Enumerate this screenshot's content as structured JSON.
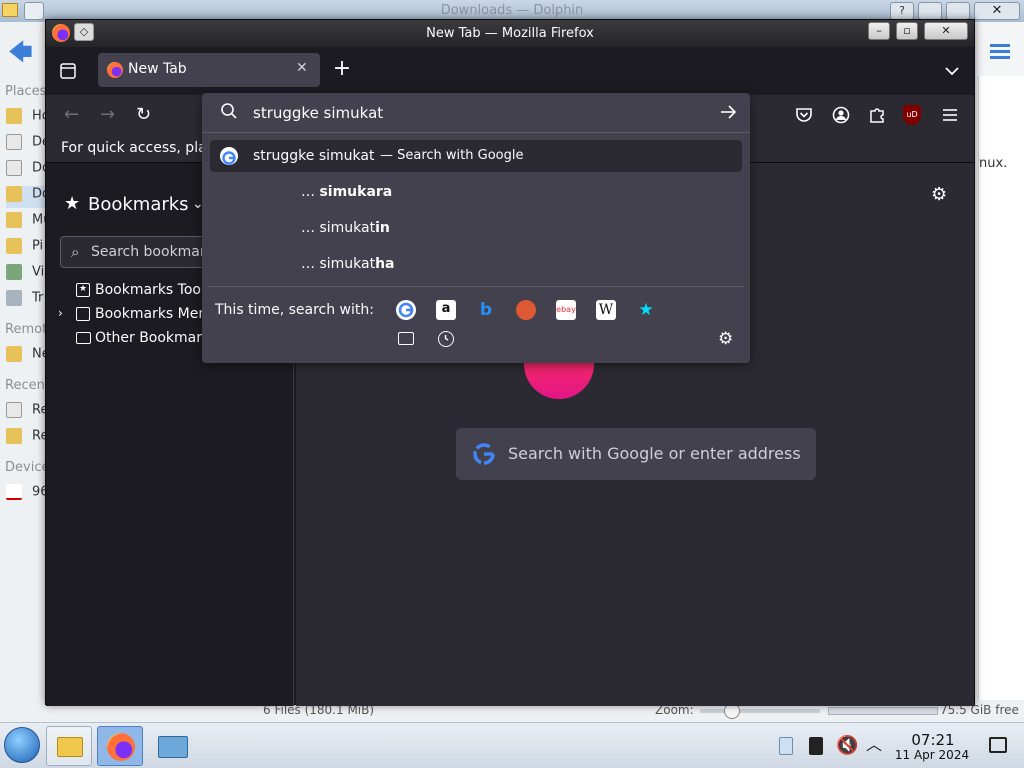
{
  "dolphin": {
    "title": "Downloads — Dolphin",
    "sidebar": {
      "places_label": "Places",
      "items_places": [
        "Ho",
        "De",
        "Do",
        "Do",
        "Mu",
        "Pi",
        "Vi",
        "Tr"
      ],
      "remote_label": "Remote",
      "items_remote": [
        "Ne"
      ],
      "recent_label": "Recent",
      "items_recent": [
        "Re",
        "Re"
      ],
      "devices_label": "Devices",
      "items_devices": [
        "96"
      ]
    },
    "right_text": "nux.",
    "status": {
      "files": "6 Files (180.1 MiB)",
      "zoom_label": "Zoom:",
      "free": "75.5 GiB free"
    }
  },
  "firefox": {
    "window_title": "New Tab — Mozilla Firefox",
    "tab_title": "New Tab",
    "bookmarks_bar_text": "For quick access, plac",
    "sidebar": {
      "title": "Bookmarks",
      "search_placeholder": "Search bookmar",
      "items": [
        "Bookmarks Tooll",
        "Bookmarks Men",
        "Other Bookmark"
      ]
    },
    "newtab_search_placeholder": "Search with Google or enter address"
  },
  "urlbar": {
    "value": "struggke simukat",
    "results": [
      {
        "main": "struggke simukat",
        "action": "— Search with Google"
      },
      {
        "prefix": "… ",
        "typed": "simuka",
        "bold": "ra"
      },
      {
        "prefix": "… ",
        "typed": "simukat",
        "bold": "in"
      },
      {
        "prefix": "… ",
        "typed": "simukat",
        "bold": "ha"
      }
    ],
    "search_with_label": "This time, search with:",
    "engines": [
      "google",
      "amazon",
      "bing",
      "duckduckgo",
      "ebay",
      "wikipedia",
      "bookmarks"
    ]
  },
  "taskbar": {
    "time": "07:21",
    "date": "11 Apr 2024"
  },
  "colors": {
    "ff_dark": "#1c1b22",
    "ff_toolbar": "#2b2a33",
    "ff_popup": "#42414d",
    "text": "#fbfbfe",
    "accent_blue": "#00ddff"
  }
}
